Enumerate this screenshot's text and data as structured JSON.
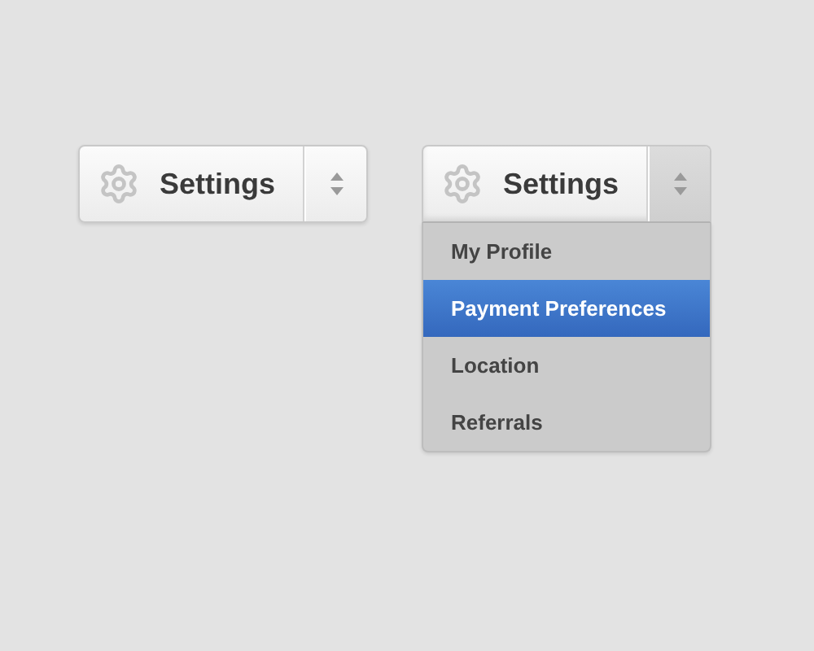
{
  "dropdowns": [
    {
      "label": "Settings",
      "expanded": false
    },
    {
      "label": "Settings",
      "expanded": true,
      "items": [
        {
          "label": "My Profile",
          "selected": false
        },
        {
          "label": "Payment Preferences",
          "selected": true
        },
        {
          "label": "Location",
          "selected": false
        },
        {
          "label": "Referrals",
          "selected": false
        }
      ]
    }
  ]
}
